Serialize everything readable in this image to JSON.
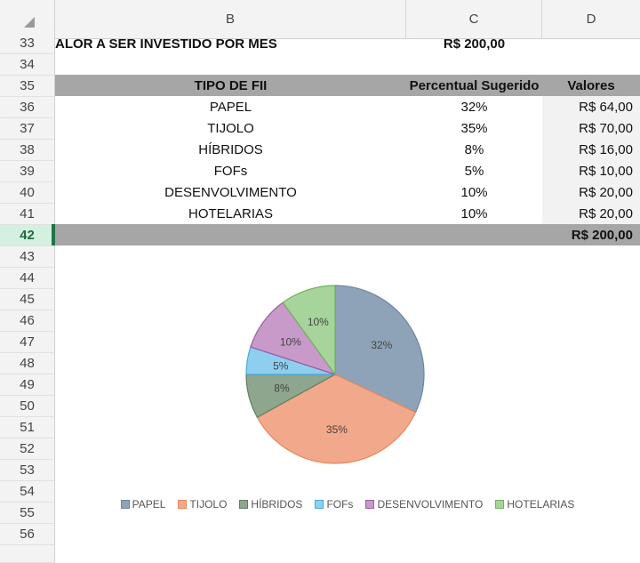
{
  "columns": [
    "B",
    "C",
    "D"
  ],
  "row_numbers": [
    "33",
    "34",
    "35",
    "36",
    "37",
    "38",
    "39",
    "40",
    "41",
    "42",
    "43",
    "44",
    "45",
    "46",
    "47",
    "48",
    "49",
    "50",
    "51",
    "52",
    "53",
    "54",
    "55",
    "56"
  ],
  "top_label": "ALOR A SER INVESTIDO POR MES",
  "top_value": "R$ 200,00",
  "table": {
    "headers": [
      "TIPO DE FII",
      "Percentual Sugerido",
      "Valores"
    ],
    "rows": [
      {
        "tipo": "PAPEL",
        "pct": "32%",
        "valor": "R$ 64,00"
      },
      {
        "tipo": "TIJOLO",
        "pct": "35%",
        "valor": "R$ 70,00"
      },
      {
        "tipo": "HÍBRIDOS",
        "pct": "8%",
        "valor": "R$ 16,00"
      },
      {
        "tipo": "FOFs",
        "pct": "5%",
        "valor": "R$ 10,00"
      },
      {
        "tipo": "DESENVOLVIMENTO",
        "pct": "10%",
        "valor": "R$ 20,00"
      },
      {
        "tipo": "HOTELARIAS",
        "pct": "10%",
        "valor": "R$ 20,00"
      }
    ],
    "total": "R$ 200,00"
  },
  "chart_data": {
    "type": "pie",
    "categories": [
      "PAPEL",
      "TIJOLO",
      "HÍBRIDOS",
      "FOFs",
      "DESENVOLVIMENTO",
      "HOTELARIAS"
    ],
    "values": [
      32,
      35,
      8,
      5,
      10,
      10
    ],
    "labels": [
      "32%",
      "35%",
      "8%",
      "5%",
      "10%",
      "10%"
    ],
    "colors": [
      "#8ea3b8",
      "#f2a88a",
      "#8ea58e",
      "#8ecff0",
      "#c79ac9",
      "#a6d49a"
    ],
    "edge_colors": [
      "#6f86a0",
      "#e8875c",
      "#5f7f5f",
      "#4aa8dc",
      "#9b5fa0",
      "#6fb35f"
    ],
    "legend_position": "bottom",
    "title": ""
  }
}
